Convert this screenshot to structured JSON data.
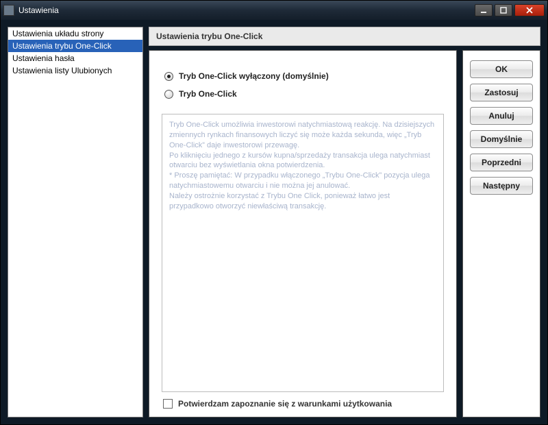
{
  "window": {
    "title": "Ustawienia"
  },
  "sidebar": {
    "items": [
      {
        "label": "Ustawienia układu strony",
        "selected": false
      },
      {
        "label": "Ustawienia trybu One-Click",
        "selected": true
      },
      {
        "label": "Ustawienia hasła",
        "selected": false
      },
      {
        "label": "Ustawienia listy Ulubionych",
        "selected": false
      }
    ]
  },
  "content": {
    "heading": "Ustawienia trybu One-Click",
    "radios": {
      "off": "Tryb One-Click wyłączony (domyślnie)",
      "on": "Tryb One-Click",
      "selected": "off"
    },
    "description": "Tryb One-Click umożliwia inwestorowi natychmiastową reakcję. Na dzisiejszych zmiennych rynkach finansowych liczyć się może każda sekunda, więc „Tryb One-Click” daje inwestorowi przewagę.\nPo kliknięciu jednego z kursów kupna/sprzedaży transakcja ulega natychmiast otwarciu bez wyświetlania okna potwierdzenia.\n* Proszę pamiętać: W przypadku włączonego „Trybu One-Click” pozycja ulega natychmiastowemu otwarciu i nie można jej anulować.\nNależy ostrożnie korzystać z Trybu One Click, ponieważ łatwo jest przypadkowo otworzyć niewłaściwą transakcję.",
    "confirm_label": "Potwierdzam zapoznanie się z warunkami użytkowania"
  },
  "buttons": {
    "ok": "OK",
    "apply": "Zastosuj",
    "cancel": "Anuluj",
    "default": "Domyślnie",
    "prev": "Poprzedni",
    "next": "Następny"
  }
}
